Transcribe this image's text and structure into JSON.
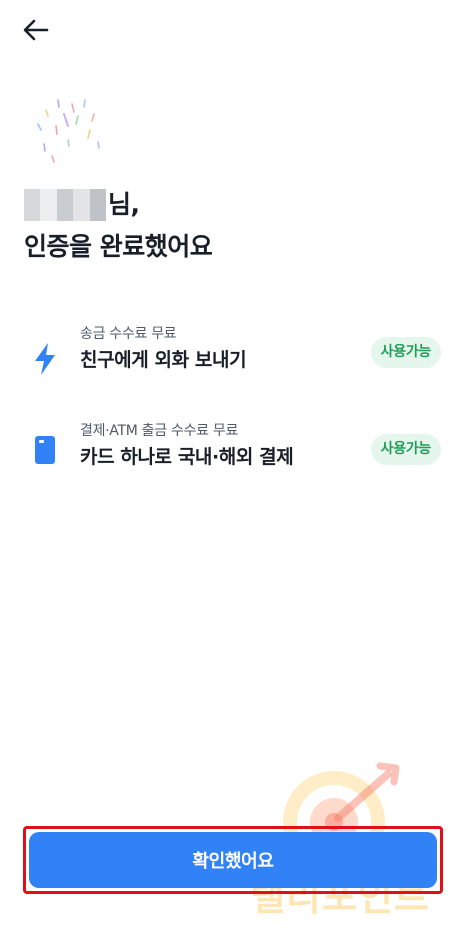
{
  "header": {
    "back_icon": "arrow-left-icon"
  },
  "hero": {
    "illustration": "confetti-icon",
    "name_suffix": "님,",
    "title": "인증을 완료했어요"
  },
  "benefits": [
    {
      "icon": "lightning-bolt-icon",
      "subtitle": "송금 수수료 무료",
      "title": "친구에게 외화 보내기",
      "badge": "사용가능"
    },
    {
      "icon": "card-icon",
      "subtitle": "결제·ATM 출금 수수료 무료",
      "title": "카드 하나로 국내·해외 결제",
      "badge": "사용가능"
    }
  ],
  "watermark": {
    "text": "랠리포인트"
  },
  "footer": {
    "confirm_label": "확인했어요"
  },
  "colors": {
    "primary": "#3182f6",
    "badge_bg": "#e5f6ec",
    "badge_text": "#1e9e5a",
    "highlight_border": "#e0101a",
    "text_primary": "#191f28",
    "text_secondary": "#4e5968"
  }
}
